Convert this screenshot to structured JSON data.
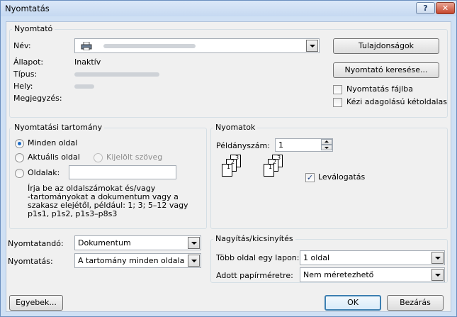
{
  "window": {
    "title": "Nyomtatás",
    "help_label": "?",
    "close_label": "✕"
  },
  "printer": {
    "group_label": "Nyomtató",
    "name_label": "Név:",
    "status_label": "Állapot:",
    "status_value": "Inaktív",
    "type_label": "Típus:",
    "location_label": "Hely:",
    "comment_label": "Megjegyzés:",
    "properties_button": "Tulajdonságok",
    "find_printer_button": "Nyomtató keresése...",
    "print_to_file_label": "Nyomtatás fájlba",
    "manual_duplex_label": "Kézi adagolású kétoldalas",
    "print_to_file_checked": false,
    "manual_duplex_checked": false
  },
  "range": {
    "group_label": "Nyomtatási tartomány",
    "all_label": "Minden oldal",
    "current_label": "Aktuális oldal",
    "selection_label": "Kijelölt szöveg",
    "pages_label": "Oldalak:",
    "pages_value": "",
    "hint_lines": [
      "Írja be az oldalszámokat és/vagy",
      "-tartományokat a dokumentum vagy a",
      "szakasz elejétől, például: 1; 3; 5–12 vagy",
      "p1s1, p1s2, p1s3–p8s3"
    ],
    "selected": "all"
  },
  "copies": {
    "group_label": "Nyomatok",
    "count_label": "Példányszám:",
    "count_value": "1",
    "collate_label": "Leválogatás",
    "collate_checked": true,
    "page_numbers": [
      "3",
      "2",
      "1"
    ]
  },
  "print_what": {
    "label": "Nyomtatandó:",
    "value": "Dokumentum"
  },
  "print_pages": {
    "label": "Nyomtatás:",
    "value": "A tartomány minden oldala"
  },
  "zoom": {
    "group_label": "Nagyítás/kicsinyítés",
    "pages_per_sheet_label": "Több oldal egy lapon:",
    "pages_per_sheet_value": "1 oldal",
    "scale_label": "Adott papírméretre:",
    "scale_value": "Nem méretezhető"
  },
  "footer": {
    "options_button": "Egyebek...",
    "ok_button": "OK",
    "close_button": "Bezárás"
  },
  "icons": {
    "printer": "printer-icon",
    "help": "help-icon",
    "close": "close-icon"
  }
}
